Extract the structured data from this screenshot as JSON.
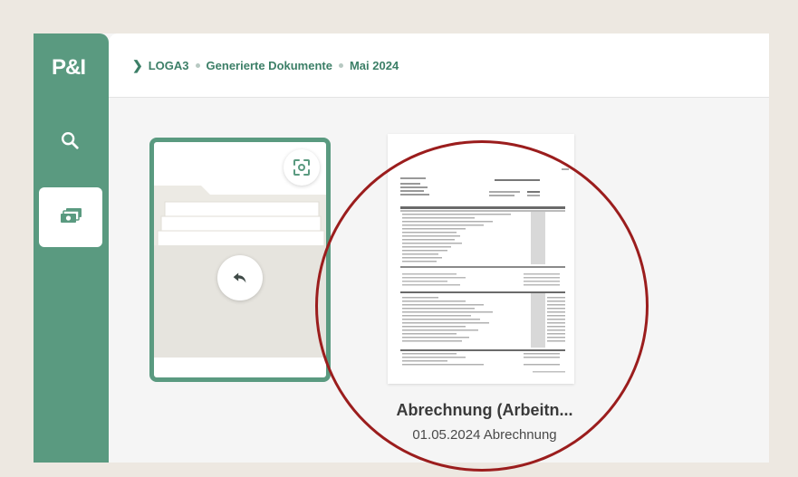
{
  "brand": {
    "logo_text": "P&I",
    "accent_color": "#5a9a80"
  },
  "sidebar": {
    "items": [
      {
        "icon": "search-icon"
      },
      {
        "icon": "money-icon",
        "active": true
      }
    ]
  },
  "breadcrumb": {
    "items": [
      "LOGA3",
      "Generierte Dokumente",
      "Mai 2024"
    ]
  },
  "folder_card": {
    "scan_icon": "scan-icon",
    "back_icon": "back-arrow-icon"
  },
  "document": {
    "title": "Abrechnung (Arbeitn...",
    "subtitle": "01.05.2024 Abrechnung"
  },
  "annotation": {
    "ring_color": "#9b1d1d"
  }
}
